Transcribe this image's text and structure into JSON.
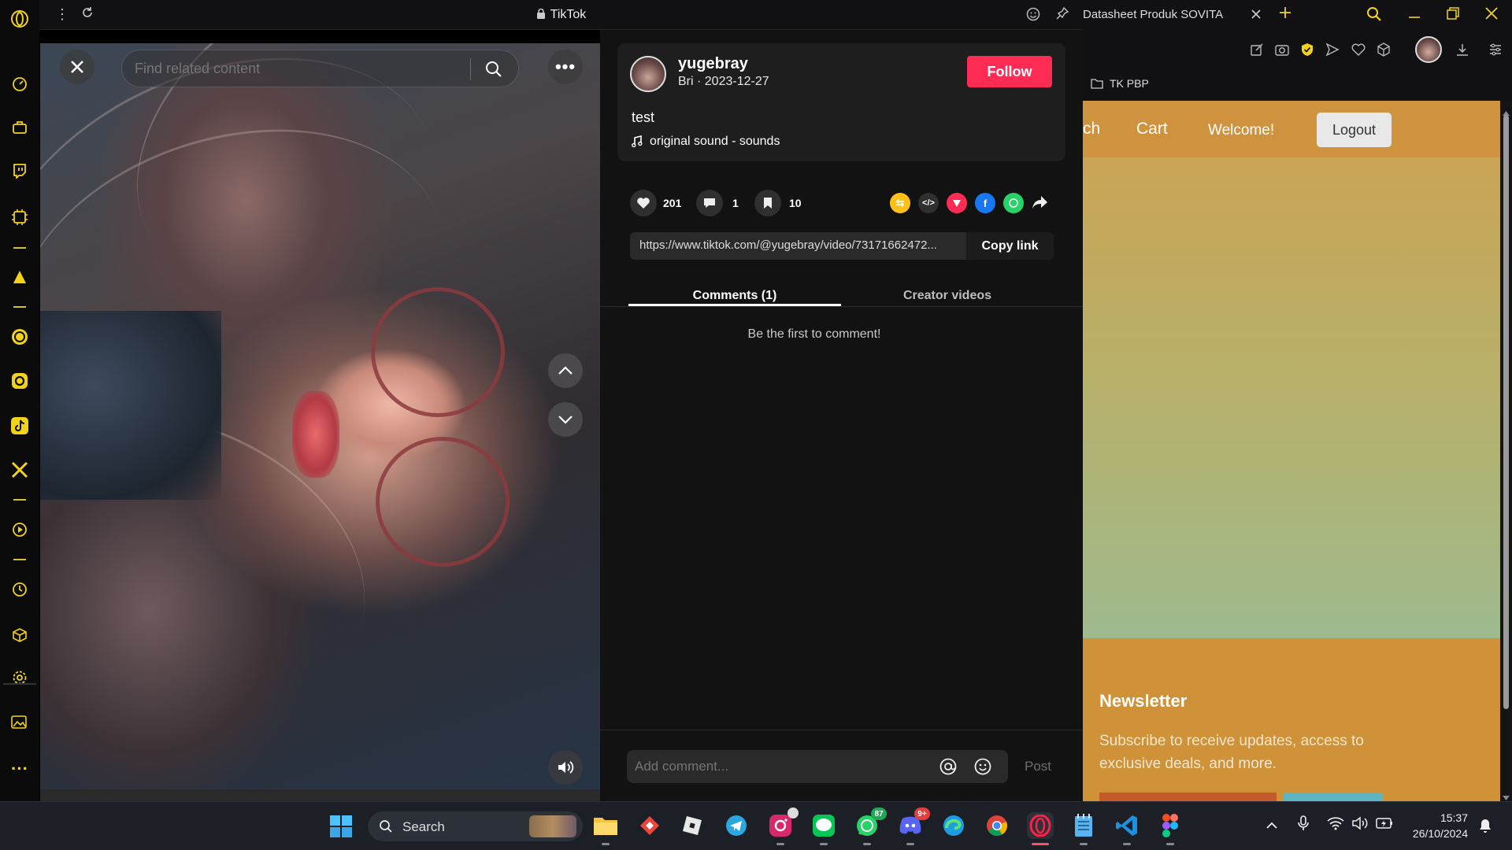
{
  "browser": {
    "tab_title": "TikTok",
    "right_tab_title": "Datasheet Produk SOVITA",
    "bookmark_folder": "TK PBP"
  },
  "tiktok": {
    "search_placeholder": "Find related content",
    "author": {
      "username": "yugebray",
      "subtitle": "Bri · 2023-12-27"
    },
    "follow_label": "Follow",
    "caption": "test",
    "sound": "original sound - sounds",
    "stats": {
      "likes": "201",
      "comments": "1",
      "saves": "10"
    },
    "link_url": "https://www.tiktok.com/@yugebray/video/73171662472...",
    "copy_link_label": "Copy link",
    "tabs": [
      "Comments (1)",
      "Creator videos"
    ],
    "empty_comments": "Be the first to comment!",
    "comment_placeholder": "Add comment...",
    "post_label": "Post"
  },
  "site": {
    "nav": {
      "partial": "ch",
      "cart": "Cart",
      "welcome": "Welcome!",
      "logout": "Logout"
    },
    "newsletter": {
      "title": "Newsletter",
      "text": "Subscribe to receive updates, access to exclusive deals, and more."
    }
  },
  "taskbar": {
    "search_label": "Search",
    "whatsapp_badge": "87",
    "discord_badge": "9+",
    "time": "15:37",
    "date": "26/10/2024"
  },
  "colors": {
    "accent_red": "#fe2c55",
    "opera_yellow": "#f3d31a",
    "site_orange": "#cf9340"
  }
}
